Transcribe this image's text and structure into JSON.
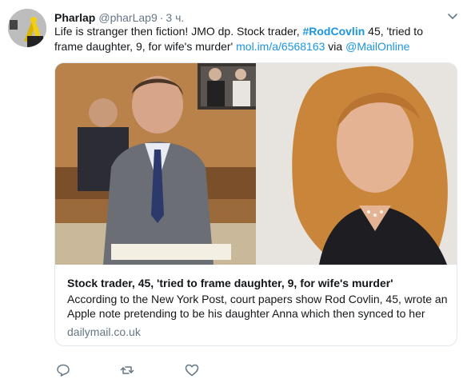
{
  "tweet": {
    "author_name": "Pharlap",
    "author_handle": "@pharLap9",
    "separator": "·",
    "time": "3 ч.",
    "text_plain_1": "Life is stranger then fiction! JMO dp. Stock trader, ",
    "hashtag": "#RodCovlin",
    "text_plain_2": " 45, 'tried to frame daughter, 9, for wife's murder' ",
    "link": "mol.im/a/6568163",
    "text_via": " via ",
    "mention": "@MailOnline"
  },
  "card": {
    "title": "Stock trader, 45, 'tried to frame daughter, 9, for wife's murder'",
    "description": "According to the New York Post, court papers show Rod Covlin, 45, wrote an Apple note pretending to be his daughter Anna which then synced to her",
    "domain": "dailymail.co.uk"
  },
  "actions": {
    "reply_icon": "reply-icon",
    "retweet_icon": "retweet-icon",
    "like_icon": "like-icon",
    "caret_icon": "chevron-down-icon"
  },
  "colors": {
    "link": "#1b95e0",
    "muted": "#657786",
    "border": "#e1e8ed"
  }
}
